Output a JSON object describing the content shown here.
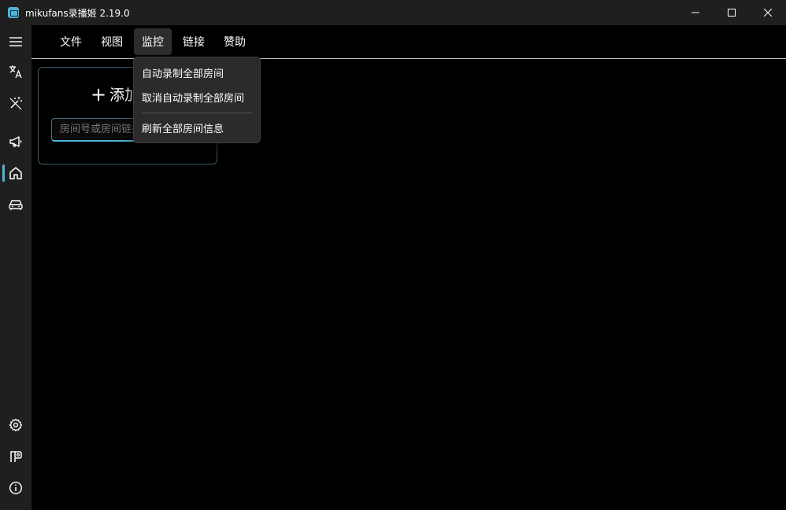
{
  "window": {
    "title": "mikufans录播姬 2.19.0",
    "icons": {
      "app": "app-logo-icon",
      "minimize": "minimize-icon",
      "maximize": "maximize-icon",
      "close": "close-icon"
    }
  },
  "sidebar": {
    "items": [
      {
        "name": "menu",
        "icon": "hamburger-icon"
      },
      {
        "name": "language",
        "icon": "translate-icon"
      },
      {
        "name": "toolbox",
        "icon": "magic-wand-off-icon"
      },
      {
        "name": "announcement",
        "icon": "megaphone-icon"
      },
      {
        "name": "home",
        "icon": "home-icon",
        "active": true
      },
      {
        "name": "vehicle",
        "icon": "car-icon"
      },
      {
        "name": "settings",
        "icon": "gear-icon"
      },
      {
        "name": "log",
        "icon": "board-icon"
      },
      {
        "name": "about",
        "icon": "info-icon"
      }
    ],
    "accent": "#4fb3d9"
  },
  "menubar": {
    "items": [
      "文件",
      "视图",
      "监控",
      "链接",
      "赞助"
    ],
    "active": "监控"
  },
  "dropdown": {
    "items": [
      "自动录制全部房间",
      "取消自动录制全部房间",
      "刷新全部房间信息"
    ]
  },
  "add_card": {
    "title": "添加",
    "input_placeholder": "房间号或房间链接"
  },
  "colors": {
    "background": "#000000",
    "chrome": "#1f1f1f",
    "accent": "#4fb3d9"
  }
}
